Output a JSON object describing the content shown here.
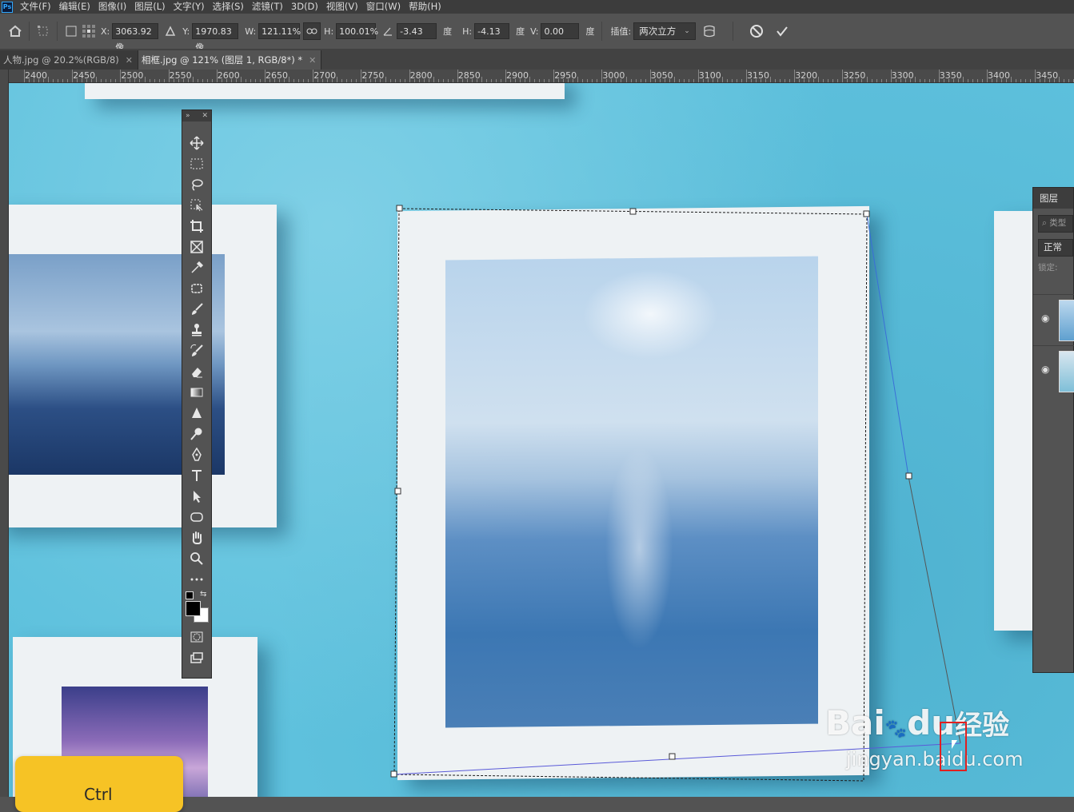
{
  "menubar": {
    "app_logo": "Ps",
    "items": [
      "文件(F)",
      "编辑(E)",
      "图像(I)",
      "图层(L)",
      "文字(Y)",
      "选择(S)",
      "滤镜(T)",
      "3D(D)",
      "视图(V)",
      "窗口(W)",
      "帮助(H)"
    ]
  },
  "options": {
    "x_label": "X:",
    "x_value": "3063.92 像",
    "y_label": "Y:",
    "y_value": "1970.83 像",
    "w_label": "W:",
    "w_value": "121.11%",
    "h_label": "H:",
    "h_value": "100.01%",
    "angle_value": "-3.43",
    "degree_unit": "度",
    "hskew_label": "H:",
    "hskew_value": "-4.13",
    "vskew_label": "V:",
    "vskew_value": "0.00",
    "interp_label": "插值:",
    "interp_value": "两次立方"
  },
  "tabs": [
    {
      "label": "人物.jpg @ 20.2%(RGB/8)"
    },
    {
      "label": "相框.jpg @ 121% (图层 1, RGB/8*) *"
    }
  ],
  "ruler": [
    "2400",
    "2450",
    "2500",
    "2550",
    "2600",
    "2650",
    "2700",
    "2750",
    "2800",
    "2850",
    "2900",
    "2950",
    "3000",
    "3050",
    "3100",
    "3150",
    "3200",
    "3250",
    "3300",
    "3350",
    "3400",
    "3450"
  ],
  "layers_panel": {
    "title": "图层",
    "search_placeholder": "类型",
    "blend_mode": "正常",
    "lock_label": "锁定:"
  },
  "overlay": {
    "ctrl_key": "Ctrl",
    "watermark_brand": "Bai",
    "watermark_du": "du",
    "watermark_cn": "经验",
    "watermark_url": "jingyan.baidu.com"
  },
  "colors": {
    "canvas_wall": "#5ec1dd",
    "frame": "#eef2f4",
    "key_yellow": "#f6c325"
  }
}
